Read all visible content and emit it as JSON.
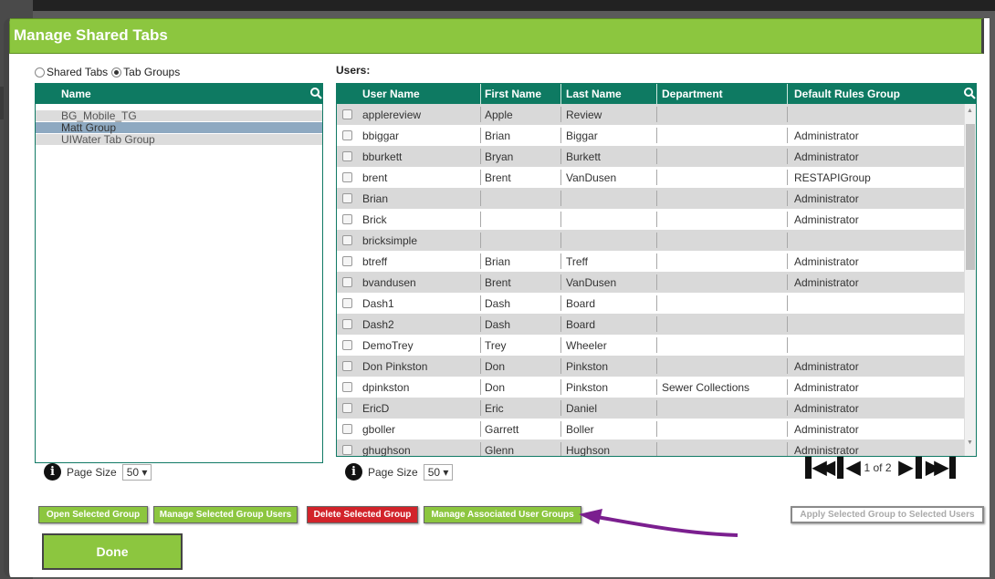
{
  "dialog": {
    "title": "Manage Shared Tabs"
  },
  "tabs_mode": {
    "option1": "Shared Tabs",
    "option2": "Tab Groups",
    "selected": "Tab Groups"
  },
  "left_grid": {
    "header": "Name",
    "rows": [
      "BG_Mobile_TG",
      "Matt Group",
      "UIWater Tab Group"
    ],
    "selected_index": 1,
    "page_size_label": "Page Size",
    "page_size": "50"
  },
  "users_grid": {
    "label": "Users:",
    "columns": [
      "User Name",
      "First Name",
      "Last Name",
      "Department",
      "Default Rules Group"
    ],
    "rows": [
      [
        "applereview",
        "Apple",
        "Review",
        "",
        ""
      ],
      [
        "bbiggar",
        "Brian",
        "Biggar",
        "",
        "Administrator"
      ],
      [
        "bburkett",
        "Bryan",
        "Burkett",
        "",
        "Administrator"
      ],
      [
        "brent",
        "Brent",
        "VanDusen",
        "",
        "RESTAPIGroup"
      ],
      [
        "Brian",
        "",
        "",
        "",
        "Administrator"
      ],
      [
        "Brick",
        "",
        "",
        "",
        "Administrator"
      ],
      [
        "bricksimple",
        "",
        "",
        "",
        ""
      ],
      [
        "btreff",
        "Brian",
        "Treff",
        "",
        "Administrator"
      ],
      [
        "bvandusen",
        "Brent",
        "VanDusen",
        "",
        "Administrator"
      ],
      [
        "Dash1",
        "Dash",
        "Board",
        "",
        ""
      ],
      [
        "Dash2",
        "Dash",
        "Board",
        "",
        ""
      ],
      [
        "DemoTrey",
        "Trey",
        "Wheeler",
        "",
        ""
      ],
      [
        "Don Pinkston",
        "Don",
        "Pinkston",
        "",
        "Administrator"
      ],
      [
        "dpinkston",
        "Don",
        "Pinkston",
        "Sewer Collections",
        "Administrator"
      ],
      [
        "EricD",
        "Eric",
        "Daniel",
        "",
        "Administrator"
      ],
      [
        "gboller",
        "Garrett",
        "Boller",
        "",
        "Administrator"
      ],
      [
        "ghughson",
        "Glenn",
        "Hughson",
        "",
        "Administrator"
      ]
    ],
    "page_size_label": "Page Size",
    "page_size": "50",
    "page_info": "1 of 2"
  },
  "buttons": {
    "open": "Open Selected Group",
    "manage_users": "Manage Selected Group Users",
    "delete": "Delete Selected Group",
    "manage_assoc": "Manage Associated User Groups",
    "apply": "Apply Selected Group to Selected Users",
    "done": "Done"
  },
  "colors": {
    "accent": "#8cc63f",
    "header": "#0e7a62",
    "danger": "#d2232a",
    "annotation": "#7b1f8f"
  }
}
